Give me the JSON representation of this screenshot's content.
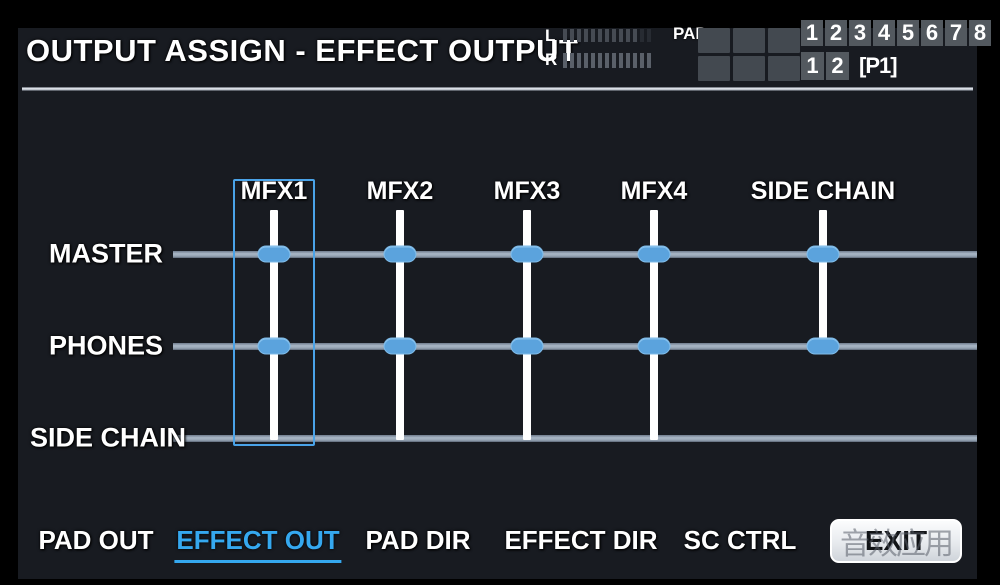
{
  "header": {
    "title": "OUTPUT ASSIGN - EFFECT OUTPUT",
    "meters": [
      {
        "label": "L",
        "segments": 13,
        "lit": 11
      },
      {
        "label": "R",
        "segments": 13,
        "lit": 13
      }
    ],
    "pad_label": "PAD",
    "pad_grid_rows": 2,
    "pad_grid_cols": 3,
    "number_strip_top": [
      "1",
      "2",
      "3",
      "4",
      "5",
      "6",
      "7",
      "8"
    ],
    "number_strip_bottom": [
      "1",
      "2"
    ],
    "patch_tag": "[P1]"
  },
  "matrix": {
    "rows": [
      {
        "label": "MASTER"
      },
      {
        "label": "PHONES"
      },
      {
        "label": "SIDE CHAIN"
      }
    ],
    "columns": [
      {
        "label": "MFX1",
        "selected": true,
        "connections": [
          "MASTER",
          "PHONES"
        ]
      },
      {
        "label": "MFX2",
        "selected": false,
        "connections": [
          "MASTER",
          "PHONES"
        ]
      },
      {
        "label": "MFX3",
        "selected": false,
        "connections": [
          "MASTER",
          "PHONES"
        ]
      },
      {
        "label": "MFX4",
        "selected": false,
        "connections": [
          "MASTER",
          "PHONES"
        ]
      },
      {
        "label": "SIDE CHAIN",
        "selected": false,
        "connections": [
          "MASTER",
          "PHONES"
        ]
      }
    ]
  },
  "footer": {
    "tabs": [
      {
        "label": "PAD OUT",
        "active": false
      },
      {
        "label": "EFFECT OUT",
        "active": true
      },
      {
        "label": "PAD DIR",
        "active": false
      },
      {
        "label": "EFFECT DIR",
        "active": false
      },
      {
        "label": "SC CTRL",
        "active": false
      }
    ],
    "exit_label": "EXIT",
    "watermark": "音效应用"
  },
  "colors": {
    "background": "#181b21",
    "accent": "#35a8ef",
    "node": "#5ba3dd",
    "row_line": "#a9b7c6",
    "col_line": "#ffffff",
    "text": "#ffffff"
  }
}
